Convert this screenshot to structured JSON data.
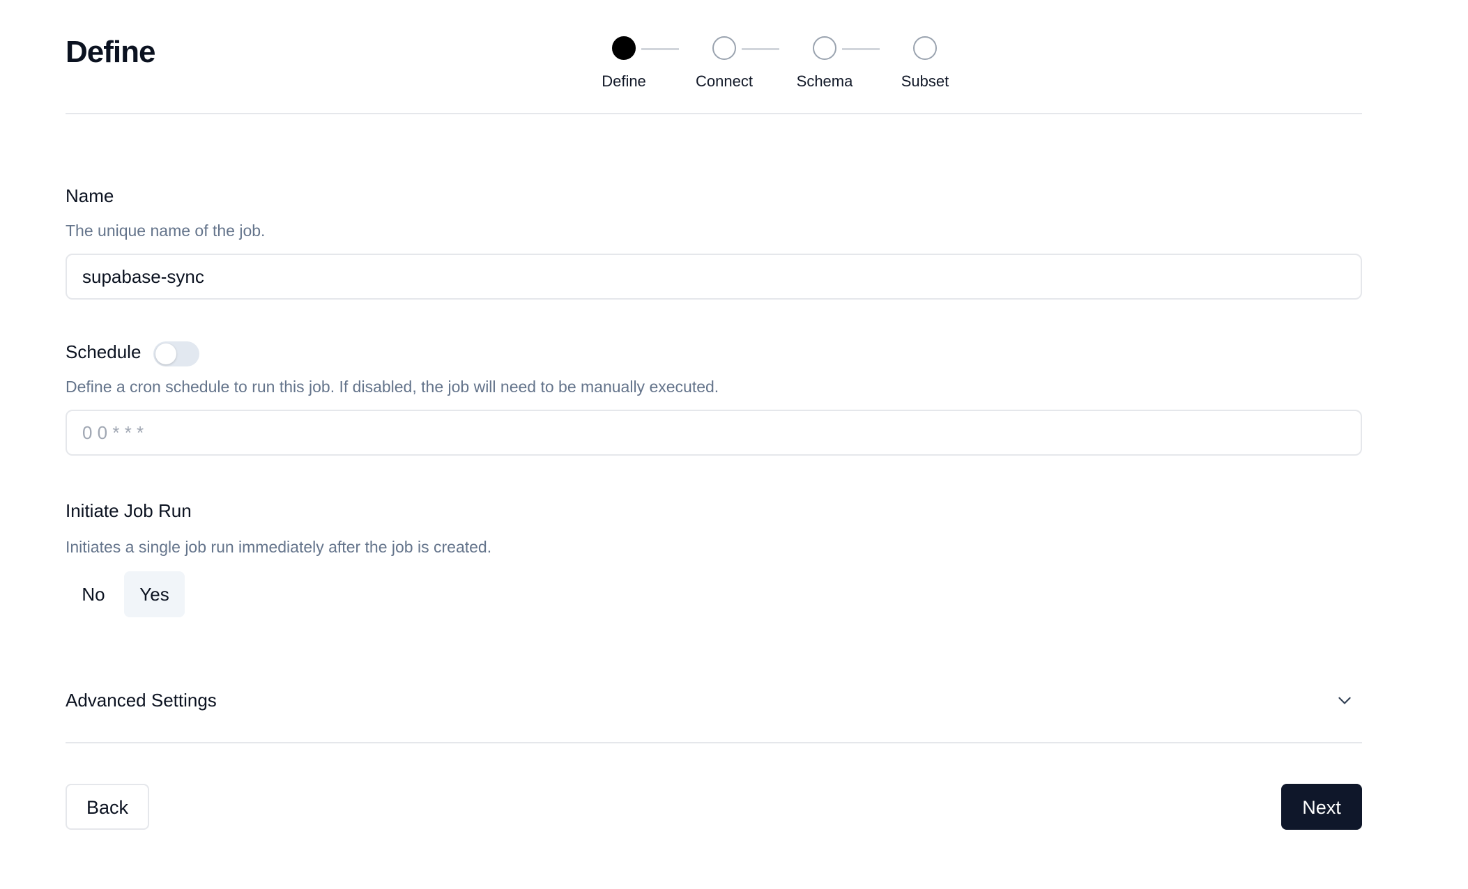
{
  "header": {
    "title": "Define"
  },
  "stepper": {
    "steps": [
      {
        "label": "Define",
        "active": true
      },
      {
        "label": "Connect",
        "active": false
      },
      {
        "label": "Schema",
        "active": false
      },
      {
        "label": "Subset",
        "active": false
      }
    ]
  },
  "name_field": {
    "label": "Name",
    "description": "The unique name of the job.",
    "value": "supabase-sync"
  },
  "schedule_field": {
    "label": "Schedule",
    "enabled": false,
    "description": "Define a cron schedule to run this job. If disabled, the job will need to be manually executed.",
    "placeholder": "0 0 * * *"
  },
  "initiate_job_run": {
    "label": "Initiate Job Run",
    "description": "Initiates a single job run immediately after the job is created.",
    "options": [
      "No",
      "Yes"
    ],
    "selected": "Yes"
  },
  "advanced_settings": {
    "label": "Advanced Settings",
    "icon": "chevron-down-icon"
  },
  "footer": {
    "back_label": "Back",
    "next_label": "Next"
  },
  "colors": {
    "primary_button": "#0f172a",
    "muted_text": "#64748b",
    "border": "#e5e7eb",
    "selected_segment": "#f1f5f9"
  }
}
